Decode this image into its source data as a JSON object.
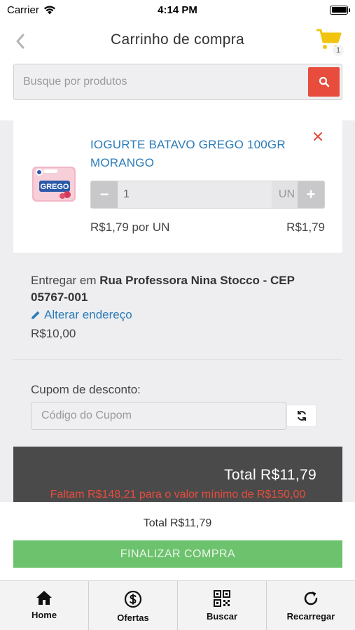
{
  "status_bar": {
    "carrier": "Carrier",
    "time": "4:14 PM"
  },
  "header": {
    "title": "Carrinho de compra",
    "cart_count": "1"
  },
  "search": {
    "placeholder": "Busque por produtos"
  },
  "cart_item": {
    "name": "IOGURTE BATAVO GREGO 100GR MORANGO",
    "image_label": "GREGO",
    "quantity": "1",
    "unit": "UN",
    "unit_price": "R$1,79 por UN",
    "line_total": "R$1,79"
  },
  "delivery": {
    "prefix": "Entregar em ",
    "address": "Rua Professora Nina Stocco - CEP 05767-001",
    "change_label": "Alterar endereço",
    "fee": "R$10,00"
  },
  "coupon": {
    "label": "Cupom de desconto:",
    "placeholder": "Código do Cupom"
  },
  "summary": {
    "total": "Total R$11,79",
    "min_warning": "Faltam R$148,21 para o valor mínimo de R$150,00"
  },
  "footer": {
    "total": "Total R$11,79",
    "checkout_label": "FINALIZAR COMPRA"
  },
  "tabs": [
    {
      "label": "Home",
      "icon": "home-icon"
    },
    {
      "label": "Ofertas",
      "icon": "dollar-circle-icon"
    },
    {
      "label": "Buscar",
      "icon": "qr-code-icon"
    },
    {
      "label": "Recarregar",
      "icon": "refresh-icon"
    }
  ],
  "colors": {
    "accent_red": "#e74c3c",
    "link_blue": "#2a7bb8",
    "cart_yellow": "#f1c40f",
    "checkout_green": "#6dc26d",
    "total_bar": "#4a4a4a"
  }
}
